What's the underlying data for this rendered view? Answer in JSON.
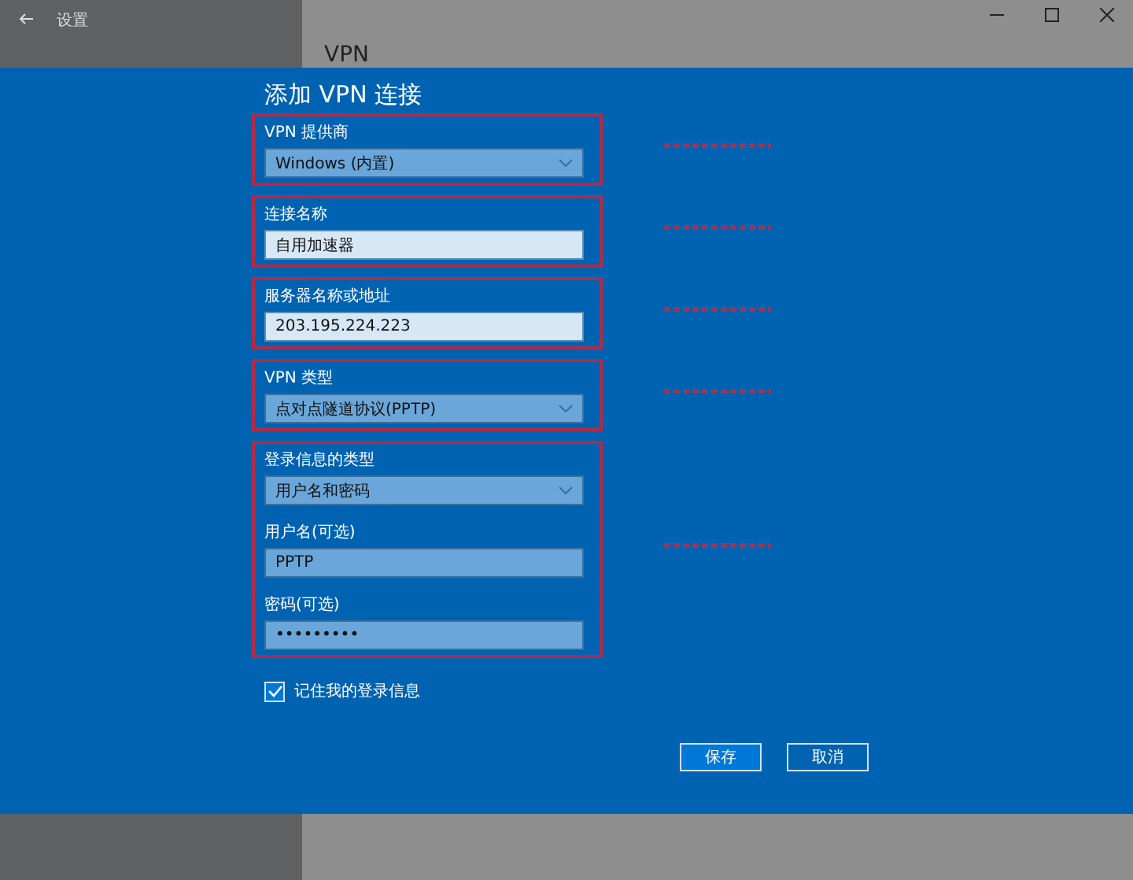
{
  "window": {
    "title": "设置"
  },
  "background_heading": "VPN",
  "dialog": {
    "title": "添加 VPN 连接",
    "groups": [
      {
        "annotated": true,
        "fields": [
          {
            "kind": "dropdown",
            "label": "VPN 提供商",
            "value": "Windows (内置)"
          }
        ]
      },
      {
        "annotated": true,
        "fields": [
          {
            "kind": "text",
            "label": "连接名称",
            "value": "自用加速器"
          }
        ]
      },
      {
        "annotated": true,
        "fields": [
          {
            "kind": "text",
            "label": "服务器名称或地址",
            "value": "203.195.224.223"
          }
        ]
      },
      {
        "annotated": true,
        "fields": [
          {
            "kind": "dropdown",
            "label": "VPN 类型",
            "value": "点对点隧道协议(PPTP)"
          }
        ]
      },
      {
        "annotated": true,
        "fields": [
          {
            "kind": "dropdown",
            "label": "登录信息的类型",
            "value": "用户名和密码"
          },
          {
            "kind": "credential",
            "label": "用户名(可选)",
            "value": "PPTP"
          },
          {
            "kind": "credential",
            "label": "密码(可选)",
            "value": "•••••••••"
          }
        ]
      }
    ],
    "remember": {
      "label": "记住我的登录信息",
      "checked": true
    },
    "buttons": [
      "保存",
      "取消"
    ]
  }
}
